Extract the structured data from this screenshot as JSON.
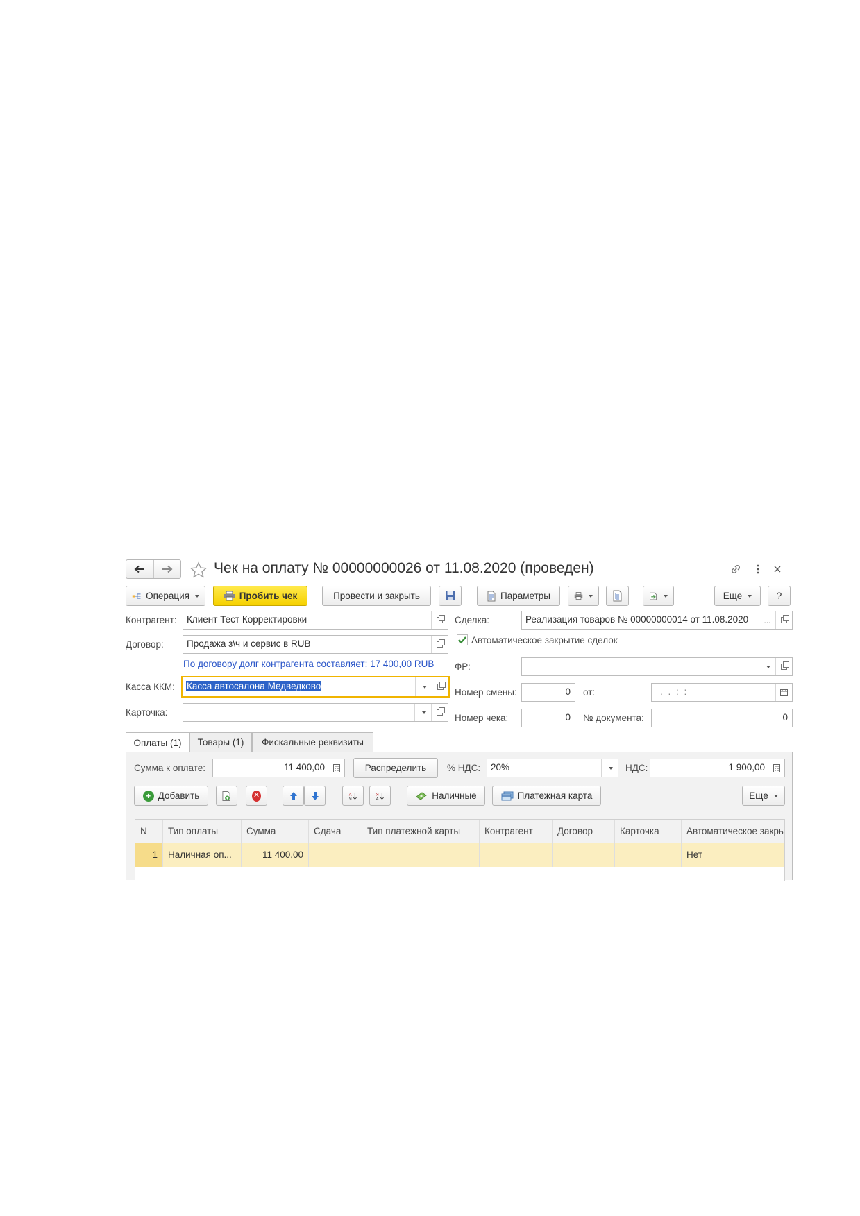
{
  "window": {
    "title": "Чек на оплату № 00000000026 от 11.08.2020 (проведен)"
  },
  "toolbar": {
    "operation": "Операция",
    "print_receipt": "Пробить чек",
    "post_close": "Провести и закрыть",
    "parameters": "Параметры",
    "more": "Еще",
    "help": "?"
  },
  "form": {
    "counterparty_label": "Контрагент:",
    "counterparty_value": "Клиент Тест Корректировки",
    "contract_label": "Договор:",
    "contract_value": "Продажа з\\ч и сервис в RUB",
    "debt_link": "По договору долг контрагента составляет: 17 400,00 RUB",
    "cashbox_label": "Касса ККМ:",
    "cashbox_value": "Касса автосалона Медведково",
    "card_label": "Карточка:",
    "card_value": "",
    "deal_label": "Сделка:",
    "deal_value": "Реализация товаров № 00000000014 от 11.08.2020",
    "deal_more": "...",
    "auto_close_label": "Автоматическое закрытие сделок",
    "auto_close_checked": true,
    "fr_label": "ФР:",
    "fr_value": "",
    "shift_label": "Номер смены:",
    "shift_value": "0",
    "from_label": "от:",
    "from_value": ". .    : :",
    "receipt_label": "Номер чека:",
    "receipt_value": "0",
    "doc_num_label": "№ документа:",
    "doc_num_value": "0"
  },
  "tabs": [
    {
      "label": "Оплаты (1)",
      "active": true
    },
    {
      "label": "Товары (1)",
      "active": false
    },
    {
      "label": "Фискальные реквизиты",
      "active": false
    }
  ],
  "payments": {
    "sum_label": "Сумма к оплате:",
    "sum_value": "11 400,00",
    "distribute": "Распределить",
    "vat_rate_label": "% НДС:",
    "vat_rate_value": "20%",
    "vat_label": "НДС:",
    "vat_value": "1 900,00",
    "add": "Добавить",
    "cash": "Наличные",
    "payment_card": "Платежная карта",
    "more": "Еще"
  },
  "table": {
    "columns": [
      "N",
      "Тип оплаты",
      "Сумма",
      "Сдача",
      "Тип платежной карты",
      "Контрагент",
      "Договор",
      "Карточка",
      "Автоматическое закрытие"
    ],
    "rows": [
      [
        "1",
        "Наличная оп...",
        "11 400,00",
        "",
        "",
        "",
        "",
        "",
        "Нет"
      ]
    ]
  },
  "colors": {
    "accent_yellow": "#f6d100",
    "focus_border": "#f0b400",
    "link": "#2a55c8",
    "selected_row": "#fbeec0"
  }
}
